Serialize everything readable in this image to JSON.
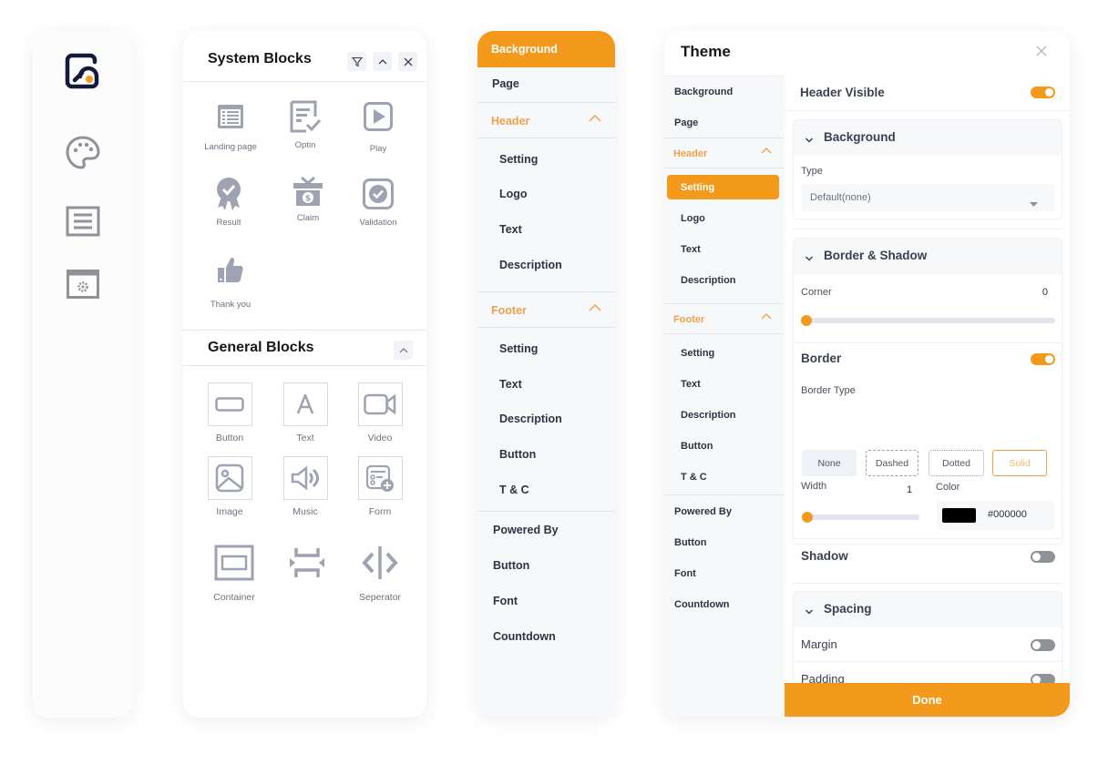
{
  "colors": {
    "accent": "#f39a1c",
    "accent_text": "#f0a04b",
    "icon_gray": "#9ea2b2",
    "brand_dark": "#131a3a"
  },
  "rail": {
    "items": [
      {
        "icon": "logo-icon"
      },
      {
        "icon": "palette-icon"
      },
      {
        "icon": "text-align-icon"
      },
      {
        "icon": "window-settings-icon"
      }
    ]
  },
  "blocks": {
    "system": {
      "title": "System Blocks",
      "actions": [
        "filter-icon",
        "chevron-up-icon",
        "close-icon"
      ],
      "items": [
        {
          "label": "Landing page",
          "icon": "list-page-icon"
        },
        {
          "label": "Optin",
          "icon": "checklist-icon"
        },
        {
          "label": "Play",
          "icon": "play-icon"
        },
        {
          "label": "Result",
          "icon": "badge-icon"
        },
        {
          "label": "Claim",
          "icon": "gift-icon"
        },
        {
          "label": "Validation",
          "icon": "check-circle-icon"
        },
        {
          "label": "Thank you",
          "icon": "thumbs-up-icon"
        }
      ]
    },
    "general": {
      "title": "General Blocks",
      "items": [
        {
          "label": "Button",
          "icon": "button-icon"
        },
        {
          "label": "Text",
          "icon": "text-icon"
        },
        {
          "label": "Video",
          "icon": "video-icon"
        },
        {
          "label": "Image",
          "icon": "image-icon"
        },
        {
          "label": "Music",
          "icon": "speaker-icon"
        },
        {
          "label": "Form",
          "icon": "form-icon"
        },
        {
          "label": "Container",
          "icon": "container-icon"
        },
        {
          "label": "",
          "icon": "spacer-icon"
        },
        {
          "label": "Seperator",
          "icon": "separator-icon"
        }
      ]
    }
  },
  "nav": {
    "active": "Background",
    "page": "Page",
    "header": {
      "label": "Header",
      "items": [
        "Setting",
        "Logo",
        "Text",
        "Description"
      ]
    },
    "footer": {
      "label": "Footer",
      "items": [
        "Setting",
        "Text",
        "Description",
        "Button",
        "T & C"
      ]
    },
    "bottom": [
      "Powered By",
      "Button",
      "Font",
      "Countdown"
    ]
  },
  "theme": {
    "title": "Theme",
    "sidebar": {
      "top": [
        "Background",
        "Page"
      ],
      "header": {
        "label": "Header",
        "active": "Setting",
        "items": [
          "Logo",
          "Text",
          "Description"
        ]
      },
      "footer": {
        "label": "Footer",
        "items": [
          "Setting",
          "Text",
          "Description",
          "Button",
          "T & C"
        ]
      },
      "bottom": [
        "Powered By",
        "Button",
        "Font",
        "Countdown"
      ]
    },
    "main": {
      "header_visible": {
        "label": "Header Visible",
        "on": true
      },
      "background": {
        "title": "Background",
        "type_label": "Type",
        "type_value": "Default(none)"
      },
      "border_shadow": {
        "title": "Border & Shadow",
        "corner_label": "Corner",
        "corner_value": "0",
        "border_label": "Border",
        "border_on": true,
        "border_type_label": "Border Type",
        "border_types": [
          "None",
          "Dashed",
          "Dotted",
          "Solid"
        ],
        "border_type_selected": "Solid",
        "width_label": "Width",
        "width_value": "1",
        "color_label": "Color",
        "color_value": "#000000",
        "shadow_label": "Shadow",
        "shadow_on": false
      },
      "spacing": {
        "title": "Spacing",
        "margin_label": "Margin",
        "margin_on": false,
        "padding_label": "Padding",
        "padding_on": false
      }
    },
    "done_label": "Done"
  }
}
